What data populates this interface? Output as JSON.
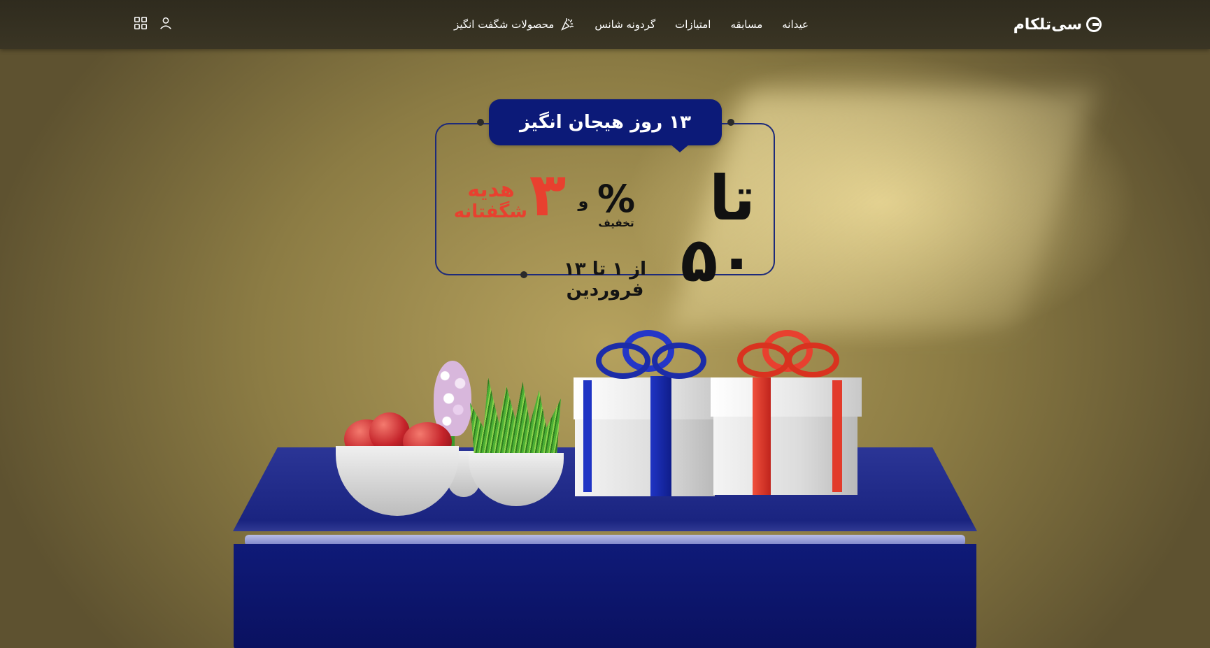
{
  "brand": {
    "logo_text": "سی‌تلکام"
  },
  "nav": {
    "items": [
      {
        "label": "عیدانه"
      },
      {
        "label": "مسابقه"
      },
      {
        "label": "امتیازات"
      },
      {
        "label": "گردونه شانس"
      },
      {
        "label": "محصولات شگفت انگیز",
        "icon": "confetti-icon"
      }
    ]
  },
  "header_icons": {
    "user": "user-icon",
    "apps": "grid-icon"
  },
  "promo": {
    "badge": "۱۳ روز هیجان انگیز",
    "offer_main": "تا ۵۰",
    "percent_sign": "%",
    "discount_label": "تخفیف",
    "and": "و",
    "gift_count": "۳",
    "gift_word": "هدیه",
    "gift_adjective": "شگفتانه",
    "date_range": "از ۱ تا ۱۳ فروردین"
  },
  "colors": {
    "header_bg": "#35311f",
    "badge_bg": "#0c1a78",
    "accent_red": "#e8402f",
    "table_blue": "#1a2480"
  }
}
